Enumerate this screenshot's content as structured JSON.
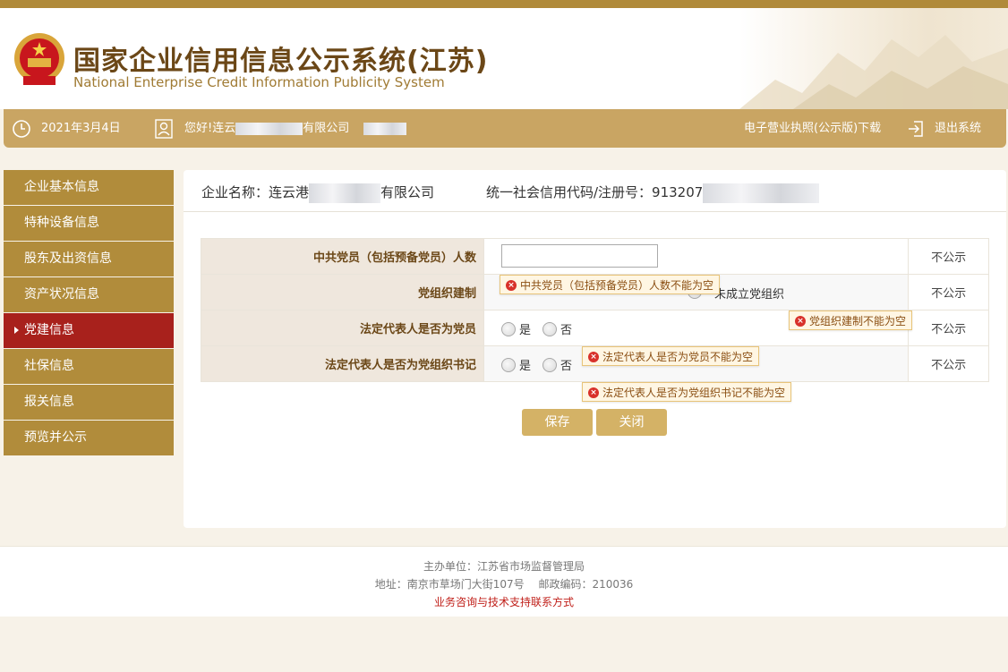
{
  "header": {
    "title_cn": "国家企业信用信息公示系统(江苏)",
    "title_en": "National Enterprise Credit Information Publicity System"
  },
  "navbar": {
    "date": "2021年3月4日",
    "greeting_prefix": "您好!连云",
    "greeting_suffix": "有限公司",
    "license_download": "电子营业执照(公示版)下载",
    "logout": "退出系统"
  },
  "sidebar": {
    "items": [
      {
        "label": "企业基本信息"
      },
      {
        "label": "特种设备信息"
      },
      {
        "label": "股东及出资信息"
      },
      {
        "label": "资产状况信息"
      },
      {
        "label": "党建信息"
      },
      {
        "label": "社保信息"
      },
      {
        "label": "报关信息"
      },
      {
        "label": "预览并公示"
      }
    ],
    "active_index": 4
  },
  "company": {
    "name_prefix": "企业名称：连云港",
    "name_suffix": "有限公司",
    "code_label": "统一社会信用代码/注册号：913207"
  },
  "form": {
    "rows": [
      {
        "question": "中共党员（包括预备党员）人数",
        "publicity": "不公示"
      },
      {
        "question": "党组织建制",
        "publicity": "不公示",
        "option_partial": "未成立党组织"
      },
      {
        "question": "法定代表人是否为党员",
        "publicity": "不公示",
        "yes": "是",
        "no": "否"
      },
      {
        "question": "法定代表人是否为党组织书记",
        "publicity": "不公示",
        "yes": "是",
        "no": "否"
      }
    ],
    "errors": {
      "party_members": "中共党员（包括预备党员）人数不能为空",
      "party_org": "党组织建制不能为空",
      "rep_member": "法定代表人是否为党员不能为空",
      "rep_secretary": "法定代表人是否为党组织书记不能为空"
    },
    "save_label": "保存",
    "close_label": "关闭"
  },
  "footer": {
    "sponsor": "主办单位：江苏省市场监督管理局",
    "address": "地址：南京市草场门大街107号　 邮政编码：210036",
    "support_link": "业务咨询与技术支持联系方式"
  },
  "colors": {
    "gold": "#c9a563",
    "sidebar": "#b18c3b",
    "active": "#a8211c",
    "title": "#6b4717"
  }
}
